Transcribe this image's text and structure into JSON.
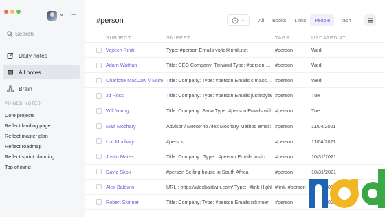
{
  "colors": {
    "accent": "#7b55d6",
    "close": "#ed6a5e",
    "minimize": "#f5bf4f",
    "zoom": "#61c554"
  },
  "window": {
    "buttons": [
      "close",
      "minimize",
      "zoom"
    ]
  },
  "sidebar": {
    "avatar": "user-avatar",
    "new_button": "+",
    "search": {
      "placeholder": "Search",
      "icon": "search-icon"
    },
    "nav": [
      {
        "label": "Daily notes",
        "icon": "edit-icon"
      },
      {
        "label": "All notes",
        "icon": "list-icon",
        "active": true
      },
      {
        "label": "Brain",
        "icon": "brain-icon"
      }
    ],
    "pinned_title": "PINNED NOTES",
    "pinned": [
      "Core projects",
      "Reflect landing page",
      "Reflect master plan",
      "Reflect roadmap",
      "Reflect sprint planning",
      "Top of mind"
    ]
  },
  "main": {
    "title": "#person",
    "filter_icon": "smiley-icon",
    "tabs": [
      {
        "label": "All"
      },
      {
        "label": "Books"
      },
      {
        "label": "Links"
      },
      {
        "label": "People",
        "active": true
      },
      {
        "label": "Trash"
      }
    ],
    "menu_icon": "menu-icon",
    "columns": {
      "subject": "SUBJECT",
      "snippet": "SNIPPET",
      "tags": "TAGS",
      "updated": "UPDATED AT"
    },
    "rows": [
      {
        "subject": "Vojtech Rinik",
        "snippet": "Type: #person Emails vojto@rinik.net",
        "tags": "#person",
        "updated": "Wed"
      },
      {
        "subject": "Adam Wathan",
        "snippet": "Title: CEO Company: Tailwind Type: #person Emails",
        "tags": "#person",
        "updated": "Wed"
      },
      {
        "subject": "Charlotte MacCaw // Mum",
        "snippet": "Title: Company: Type: #person Emails c.maccaw",
        "tags": "#person",
        "updated": "Wed"
      },
      {
        "subject": "Jd Ross",
        "snippet": "Title: Company: Type: #person Emails justindyla",
        "tags": "#person",
        "updated": "Tue"
      },
      {
        "subject": "Will Young",
        "snippet": "Title: Company: Sana Type: #person Emails will",
        "tags": "#person",
        "updated": "Tue"
      },
      {
        "subject": "Matt Mochary",
        "snippet": "Advisor / Mentor to Alex Mochary Method email:",
        "tags": "#person",
        "updated": "11/04/2021"
      },
      {
        "subject": "Luc Mochary",
        "snippet": "#person",
        "tags": "#person",
        "updated": "11/04/2021"
      },
      {
        "subject": "Justin Mares",
        "snippet": "Title: Company:: Type:: #person Emails justin",
        "tags": "#person",
        "updated": "10/31/2021"
      },
      {
        "subject": "David Skok",
        "snippet": "#person Selling house in South Africa",
        "tags": "#person",
        "updated": "10/31/2021"
      },
      {
        "subject": "Alex Baldwin",
        "snippet": "URL:: https://alexbaldwin.com/ Type:: #link Highl",
        "tags": "#link, #person",
        "updated": "10/30/2021"
      },
      {
        "subject": "Robert Skinner",
        "snippet": "Title: Company: Type: #person Emails rskinner",
        "tags": "#person",
        "updated": "10/29/2021"
      }
    ]
  },
  "logo": {
    "text": "ncd",
    "colors": [
      "#1e63b4",
      "#f3b623",
      "#3aa845"
    ]
  }
}
